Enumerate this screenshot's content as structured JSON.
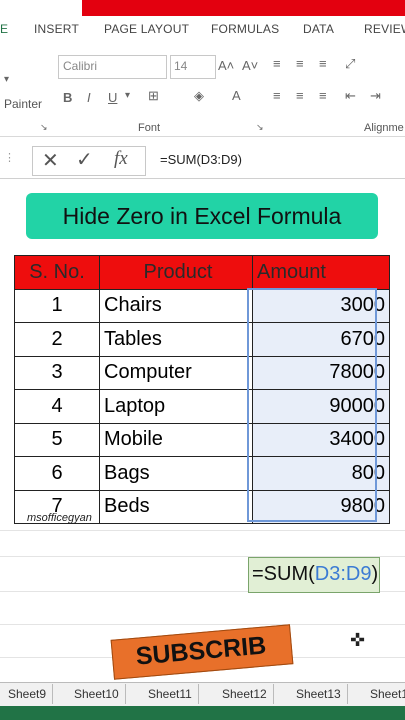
{
  "ribbon": {
    "tabs": [
      "E",
      "INSERT",
      "PAGE LAYOUT",
      "FORMULAS",
      "DATA",
      "REVIEW"
    ],
    "font_name": "Calibri",
    "font_size": "14",
    "painter_label": "Painter",
    "font_group_label": "Font",
    "alignment_group_label": "Alignme"
  },
  "formula_bar": {
    "fx_label": "fx",
    "content": "=SUM(D3:D9)"
  },
  "title": "Hide Zero in Excel Formula",
  "table": {
    "headers": [
      "S. No.",
      "Product",
      "Amount"
    ],
    "rows": [
      [
        "1",
        "Chairs",
        "3000"
      ],
      [
        "2",
        "Tables",
        "6700"
      ],
      [
        "3",
        "Computer",
        "78000"
      ],
      [
        "4",
        "Laptop",
        "90000"
      ],
      [
        "5",
        "Mobile",
        "34000"
      ],
      [
        "6",
        "Bags",
        "800"
      ],
      [
        "7",
        "Beds",
        "9800"
      ]
    ]
  },
  "formula_cell": {
    "prefix": "=SUM(",
    "range": "D3:D9",
    "suffix": ")"
  },
  "watermark": "msofficegyan",
  "subscribe_label": "SUBSCRIB",
  "sheets": [
    "Sheet9",
    "Sheet10",
    "Sheet11",
    "Sheet12",
    "Sheet13",
    "Sheet1"
  ],
  "colors": {
    "header_red": "#ee0d0d",
    "title_green": "#22d3a6",
    "subscribe_orange": "#e8702a",
    "selection_blue": "#e8eef9",
    "formula_cell_green": "#e1efd5"
  }
}
